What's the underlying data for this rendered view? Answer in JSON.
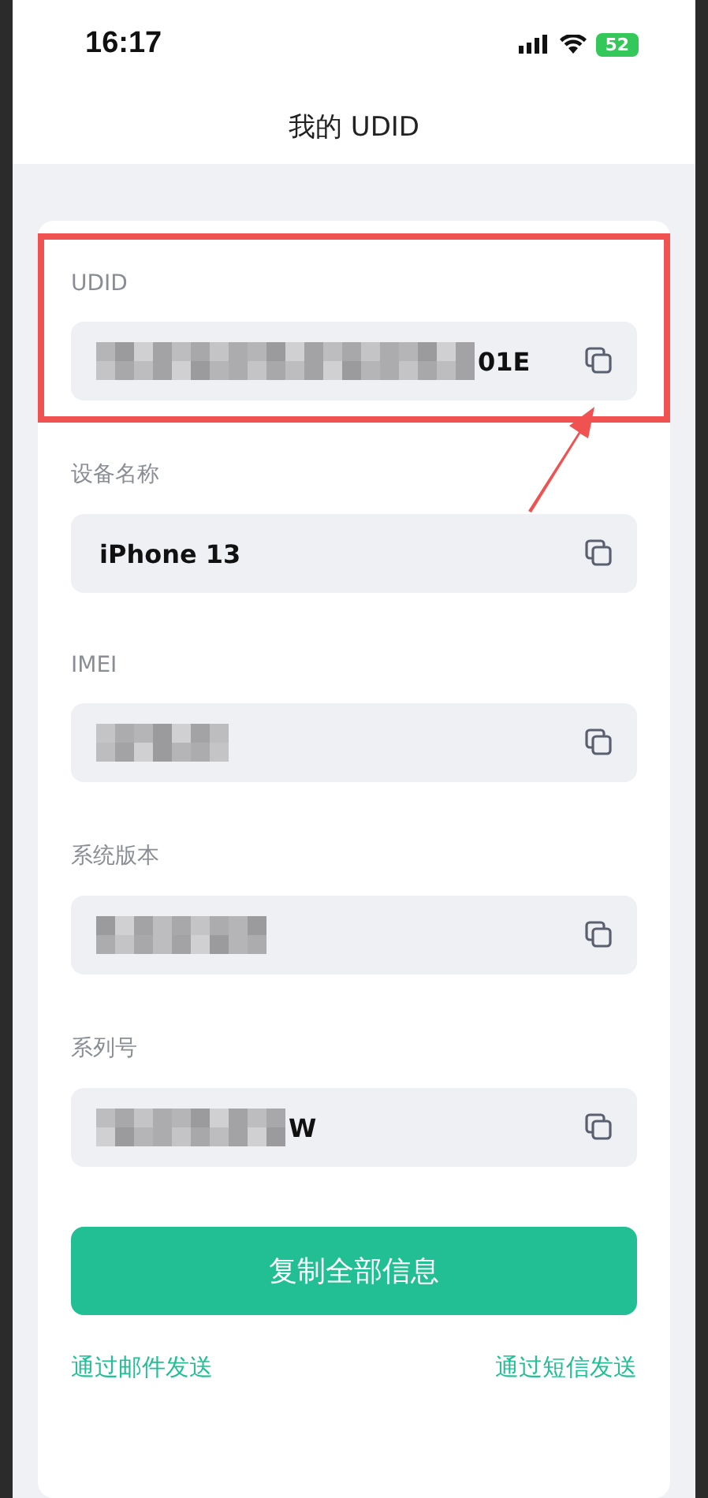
{
  "status_bar": {
    "time": "16:17",
    "battery": "52"
  },
  "title": "我的 UDID",
  "fields": [
    {
      "label": "UDID",
      "value": "01E",
      "redacted": true,
      "highlighted": true
    },
    {
      "label": "设备名称",
      "value": "iPhone 13",
      "redacted": false,
      "highlighted": false
    },
    {
      "label": "IMEI",
      "redacted": true,
      "highlighted": false
    },
    {
      "label": "系统版本",
      "redacted": true,
      "highlighted": false
    },
    {
      "label": "系列号",
      "value": "W",
      "redacted": true,
      "highlighted": false
    }
  ],
  "copy_all_button": "复制全部信息",
  "links": [
    "通过邮件发送",
    "通过短信发送"
  ]
}
